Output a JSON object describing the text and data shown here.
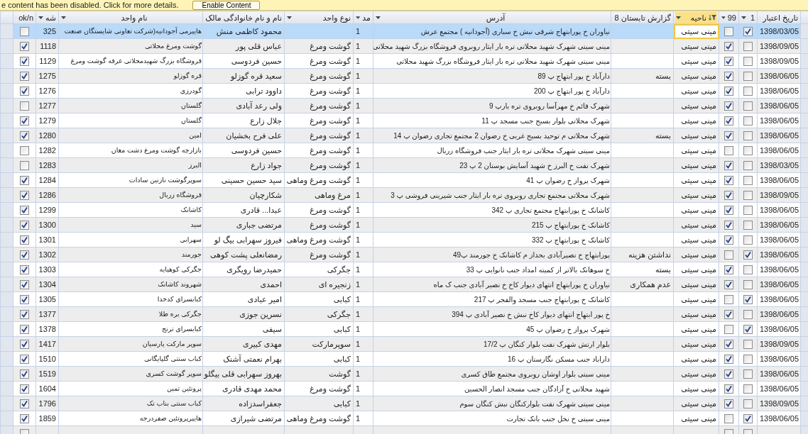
{
  "message_bar": {
    "text": "e content has been disabled. Click for more details.",
    "button": "Enable Content"
  },
  "table": {
    "columns": [
      {
        "label": "تاریخ اعتبار",
        "filtered": false
      },
      {
        "label": "1",
        "filtered": false
      },
      {
        "label": "99",
        "filtered": false
      },
      {
        "label": "ناحیه",
        "filtered": true
      },
      {
        "label": "گزارش تابستان 8",
        "filtered": false
      },
      {
        "label": "آدرس",
        "filtered": false
      },
      {
        "label": "مد",
        "filtered": false
      },
      {
        "label": "نوع واحد",
        "filtered": false
      },
      {
        "label": "نام و نام خانوادگی مالک",
        "filtered": false
      },
      {
        "label": "نام واحد",
        "filtered": false
      },
      {
        "label": "شه",
        "filtered": false
      },
      {
        "label": "ok/n",
        "filtered": false
      }
    ],
    "rows": [
      {
        "selected": true,
        "date": "1398/03/05",
        "flag_1": true,
        "flag_99": false,
        "district": "مینی سیتی",
        "address": "نیاوران خ پورابتهاج شرقی نبش خ سباری  (آجودانیه ) مجتمع عرش",
        "column_mod": "1",
        "owner": "محمود کاظمی منش",
        "unit_name": "هایپرمی آجودانیه(شرکت تعاونی شایستگان صنعت",
        "number": "325",
        "ok": false
      },
      {
        "selected": false,
        "date": "1398/09/05",
        "flag_1": false,
        "flag_99": true,
        "district": "مینی سیتی",
        "address": "مینی سیتی شهرک شهید محلاتی تره بار ایثار روبروی فروشگاه بزرگ شهید محلاتی",
        "column_mod": "1",
        "unit_type": "گوشت ومرغ",
        "owner": "عباس قلی پور",
        "unit_name": "گوشت ومرغ محلاتی",
        "number": "1118",
        "ok": true
      },
      {
        "selected": false,
        "date": "1398/09/05",
        "flag_1": false,
        "flag_99": true,
        "district": "مینی سیتی",
        "address": "مینی سیتی شهرک شهید محلاتی تره بار ایثار فروشگاه بزرگ شهید محلاتی",
        "column_mod": "1",
        "unit_type": "گوشت ومرغ",
        "owner": "حسین فردوسی",
        "unit_name": "فروشگاه بزرگ شهیدمحلاتی غرفه گوشت ومرغ",
        "number": "1129",
        "ok": true
      },
      {
        "selected": false,
        "date": "1398/06/05",
        "flag_1": false,
        "flag_99": true,
        "district": "مینی سیتی",
        "summer_report": "بسته",
        "address": "دارآباد خ پور ابتهاج پ 89",
        "column_mod": "1",
        "unit_type": "گوشت ومرغ",
        "owner": "سعید قره گوزلو",
        "unit_name": "قره گوزلو",
        "number": "1275",
        "ok": true
      },
      {
        "selected": false,
        "date": "1398/06/05",
        "flag_1": false,
        "flag_99": true,
        "district": "مینی سیتی",
        "address": "دارآباد خ پور ابتهاج پ 200",
        "column_mod": "1",
        "unit_type": "گوشت ومرغ",
        "owner": "داوود ترابی",
        "unit_name": "گودرزی",
        "number": "1276",
        "ok": true
      },
      {
        "selected": false,
        "date": "1398/06/05",
        "flag_1": false,
        "flag_99": true,
        "district": "مینی سیتی",
        "address": "شهرک قائم خ مهرآسا روبروی تره بارپ 9",
        "column_mod": "1",
        "unit_type": "گوشت ومرغ",
        "owner": "ولی رعد آبادی",
        "unit_name": "گلستان",
        "number": "1277",
        "ok": false
      },
      {
        "selected": false,
        "date": "1398/06/05",
        "flag_1": false,
        "flag_99": true,
        "district": "مینی سیتی",
        "address": "شهرک محلاتی بلوار بسیج جنب مسجد پ 11",
        "column_mod": "1",
        "unit_type": "گوشت ومرغ",
        "owner": "جلال زارع",
        "unit_name": "گلستان",
        "number": "1279",
        "ok": true
      },
      {
        "selected": false,
        "date": "1398/06/05",
        "flag_1": false,
        "flag_99": true,
        "district": "مینی سیتی",
        "summer_report": "بسته",
        "address": "شهرک محلاتی م توحید بسیج غربی خ رضوان 2 مجتمع تجاری رضوان پ 14",
        "column_mod": "1",
        "unit_type": "گوشت ومرغ",
        "owner": "علی فرح بخشیان",
        "unit_name": "امین",
        "number": "1280",
        "ok": true
      },
      {
        "selected": false,
        "date": "1398/06/05",
        "flag_1": false,
        "flag_99": false,
        "district": "مینی سیتی",
        "address": "مینی سیتی شهرک محلاتی تره بار ایثار جنب فروشگاه زربال",
        "column_mod": "1",
        "unit_type": "گوشت ومرغ",
        "owner": "حسین فردوسی",
        "unit_name": "بازارچه گوشت ومرغ دشت مغان",
        "number": "1282",
        "ok": false
      },
      {
        "selected": false,
        "date": "1398/03/05",
        "flag_1": false,
        "flag_99": true,
        "district": "مینی سیتی",
        "address": "شهرک نفت خ البرز خ شهید آسایش بوستان 2 پ 23",
        "column_mod": "1",
        "unit_type": "گوشت ومرغ",
        "owner": "جواد زارع",
        "unit_name": "البرز",
        "number": "1283",
        "ok": false
      },
      {
        "selected": false,
        "date": "1398/06/05",
        "flag_1": false,
        "flag_99": true,
        "district": "مینی سیتی",
        "address": "شهرک پرواز خ رضوان پ 41",
        "column_mod": "1",
        "unit_type": "گوشت ومرغ وماهی",
        "owner": "سید حسین حسینی",
        "unit_name": "سوپرگوشت نازنین سادات",
        "number": "1284",
        "ok": true
      },
      {
        "selected": false,
        "date": "1398/09/05",
        "flag_1": false,
        "flag_99": true,
        "district": "مینی سیتی",
        "address": "شهرک محلاتی مجتمع تجاری روبروی تره بار ایثار جنب شیرینی فروشی پ 3",
        "column_mod": "1",
        "unit_type": "مرغ وماهی",
        "owner": "شکارچیان",
        "unit_name": "فروشگاه زربال",
        "number": "1286",
        "ok": true
      },
      {
        "selected": false,
        "date": "1398/06/05",
        "flag_1": false,
        "flag_99": true,
        "district": "مینی سیتی",
        "address": "کاشانک خ پورابتهاج مجتمع تجاری پ 342",
        "column_mod": "1",
        "unit_type": "گوشت ومرغ",
        "owner": "عبدا... قادری",
        "unit_name": "کاشانک",
        "number": "1299",
        "ok": true
      },
      {
        "selected": false,
        "date": "1398/06/05",
        "flag_1": false,
        "flag_99": true,
        "district": "مینی سیتی",
        "address": "کاشانک خ پورابتهاج پ 215",
        "column_mod": "1",
        "unit_type": "گوشت ومرغ",
        "owner": "مرتضی جباری",
        "unit_name": "سید",
        "number": "1300",
        "ok": true
      },
      {
        "selected": false,
        "date": "1398/06/05",
        "flag_1": false,
        "flag_99": true,
        "district": "مینی سیتی",
        "address": "کاشانک خ پورابتهاج پ 332",
        "column_mod": "1",
        "unit_type": "گوشت ومرغ وماهی",
        "owner": "فیروز سهرابی بیگ لو",
        "unit_name": "سهرابی",
        "number": "1301",
        "ok": true
      },
      {
        "selected": false,
        "date": "1398/06/05",
        "flag_1": true,
        "flag_99": false,
        "district": "مینی سیتی",
        "summer_report": "نداشتن هزینه",
        "address": "پورابتهاج خ نصیرآبادی بحداز م کاشانک خ جورمند پ49",
        "column_mod": "1",
        "unit_type": "گوشت ومرغ",
        "owner": "رمضانعلی پشت کوهی",
        "unit_name": "جورمند",
        "number": "1302",
        "ok": true
      },
      {
        "selected": false,
        "date": "1398/06/05",
        "flag_1": false,
        "flag_99": true,
        "district": "مینی سیتی",
        "summer_report": "بسته",
        "address": "خ سوهانک بالاتر از کمیته امداد جنب نانوایی پ 33",
        "column_mod": "1",
        "unit_type": "جگرکی",
        "owner": "حمیدرضا رویگری",
        "unit_name": "جگرکی کوهپایه",
        "number": "1303",
        "ok": true
      },
      {
        "selected": false,
        "date": "1398/06/05",
        "flag_1": false,
        "flag_99": true,
        "district": "مینی سیتی",
        "summer_report": "عدم همکاری",
        "address": "نیاوران خ پورابتهاج انتهای دیوار کاخ  خ نصیر آبادی جنب ک ماه",
        "column_mod": "1",
        "unit_type": "زنجیره ای",
        "owner": "احمدی",
        "unit_name": "شهروند کاشانک",
        "number": "1304",
        "ok": true
      },
      {
        "selected": false,
        "date": "1398/06/05",
        "flag_1": true,
        "flag_99": false,
        "district": "مینی سیتی",
        "address": "کاشانک خ پورابتهاج جنب مسجد والفجر پ 217",
        "column_mod": "1",
        "unit_type": "کبابی",
        "owner": "امیر عبادی",
        "unit_name": "کبابسرای کدخدا",
        "number": "1305",
        "ok": true
      },
      {
        "selected": false,
        "date": "1398/06/05",
        "flag_1": false,
        "flag_99": true,
        "district": "مینی سیتی",
        "address": "خ پور ابتهاج انتهای دیوار کاخ نبش خ نصیر آبادی پ 394",
        "column_mod": "1",
        "unit_type": "جگرکی",
        "owner": "نسرین جوزی",
        "unit_name": "جگرکی بره طلا",
        "number": "1377",
        "ok": true
      },
      {
        "selected": false,
        "date": "1398/06/05",
        "flag_1": true,
        "flag_99": false,
        "district": "مینی سیتی",
        "address": "شهرک پرواز خ رضوان پ 45",
        "column_mod": "1",
        "unit_type": "کبابی",
        "owner": "سیفی",
        "unit_name": "کبابسرای ترنج",
        "number": "1378",
        "ok": true
      },
      {
        "selected": false,
        "date": "1398/09/05",
        "flag_1": false,
        "flag_99": true,
        "district": "مینی سیتی",
        "address": "بلوار ارتش شهرک نفت بلوار کنگان پ 17/2",
        "column_mod": "1",
        "unit_type": "سوپرمارکت",
        "owner": "مهدی کبیری",
        "unit_name": "سوپر مارکت پارسیان",
        "number": "1417",
        "ok": true
      },
      {
        "selected": false,
        "date": "1398/06/05",
        "flag_1": false,
        "flag_99": true,
        "district": "مینی سیتی",
        "address": "داراباد  جنب مسکن نگارستان پ 16",
        "column_mod": "1",
        "unit_type": "کبابی",
        "owner": "بهرام نعمتی آشنک",
        "unit_name": "کباب سنتی گلپایگانی",
        "number": "1510",
        "ok": true
      },
      {
        "selected": false,
        "date": "1398/06/05",
        "flag_1": false,
        "flag_99": true,
        "district": "مینی سیتی",
        "address": "مینی سیتی بلوار اوشان روبروی مجتمع طاق کسری",
        "column_mod": "1",
        "unit_type": "گوشت",
        "owner": "بهروز سهرابی قلی بیگلو",
        "unit_name": "سوپر گوشت کسری",
        "number": "1519",
        "ok": true
      },
      {
        "selected": false,
        "date": "1398/06/05",
        "flag_1": false,
        "flag_99": true,
        "district": "مینی سیتی",
        "address": "شهید محلاتی خ آزادگان جنب مسجد انصار الحسین",
        "column_mod": "1",
        "unit_type": "گوشت ومرغ",
        "owner": "محمد مهدی قادری",
        "unit_name": "پروتئین ثمین",
        "number": "1604",
        "ok": true
      },
      {
        "selected": false,
        "date": "1398/09/05",
        "flag_1": false,
        "flag_99": true,
        "district": "مینی سیتی",
        "address": "مینی سیتی شهرک نفت بلوارکنگان نبش کنگان سوم",
        "column_mod": "1",
        "unit_type": "کبابی",
        "owner": "جعفراسدزاده",
        "unit_name": "کباب سنتی بناب تک",
        "number": "1796",
        "ok": true
      },
      {
        "selected": false,
        "date": "1398/06/05",
        "flag_1": true,
        "flag_99": false,
        "district": "مینی سیتی",
        "address": "مینی سیتی خ نخل جنب بانک تجارت",
        "column_mod": "1",
        "unit_type": "گوشت ومرغ وماهی",
        "owner": "مرتضی شیرازی",
        "unit_name": "هایپرپروتئین صفردرجه",
        "number": "1859",
        "ok": true
      }
    ],
    "new_row": {
      "flag_1": false,
      "flag_99": false,
      "ok": false
    }
  }
}
